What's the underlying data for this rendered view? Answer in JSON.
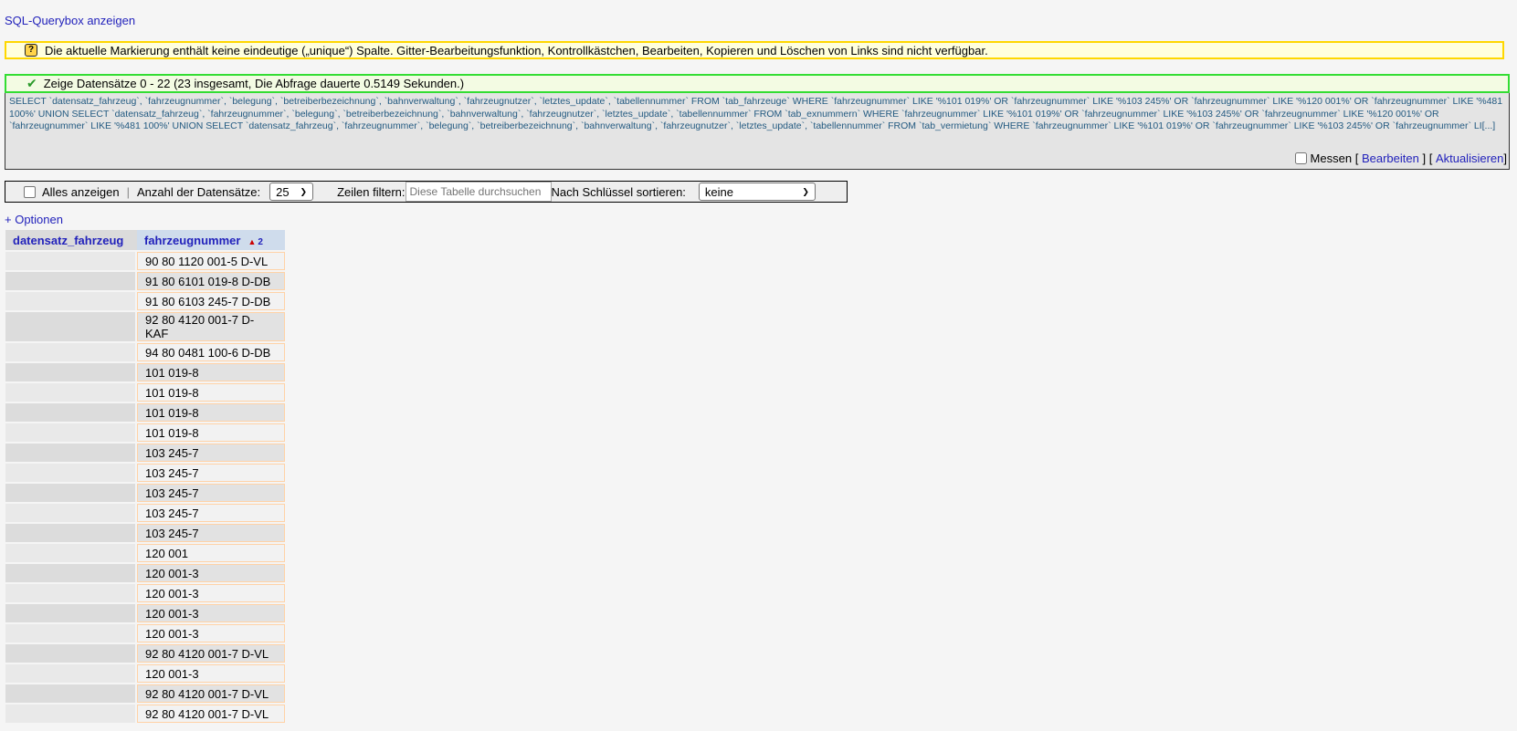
{
  "toplink": "SQL-Querybox anzeigen",
  "notice": "Die aktuelle Markierung enthält keine eindeutige („unique“) Spalte. Gitter-Bearbeitungsfunktion, Kontrollkästchen, Bearbeiten, Kopieren und Löschen von Links sind nicht verfügbar.",
  "success": "Zeige Datensätze 0 - 22 (23 insgesamt, Die Abfrage dauerte 0.5149 Sekunden.)",
  "sql": "SELECT `datensatz_fahrzeug`, `fahrzeugnummer`, `belegung`, `betreiberbezeichnung`, `bahnverwaltung`, `fahrzeugnutzer`, `letztes_update`, `tabellennummer` FROM `tab_fahrzeuge` WHERE `fahrzeugnummer` LIKE '%101 019%' OR `fahrzeugnummer` LIKE '%103 245%' OR `fahrzeugnummer` LIKE '%120 001%' OR `fahrzeugnummer` LIKE '%481 100%' UNION SELECT `datensatz_fahrzeug`, `fahrzeugnummer`, `belegung`, `betreiberbezeichnung`, `bahnverwaltung`, `fahrzeugnutzer`, `letztes_update`, `tabellennummer` FROM `tab_exnummern` WHERE `fahrzeugnummer` LIKE '%101 019%' OR `fahrzeugnummer` LIKE '%103 245%' OR `fahrzeugnummer` LIKE '%120 001%' OR `fahrzeugnummer` LIKE '%481 100%' UNION SELECT `datensatz_fahrzeug`, `fahrzeugnummer`, `belegung`, `betreiberbezeichnung`, `bahnverwaltung`, `fahrzeugnutzer`, `letztes_update`, `tabellennummer` FROM `tab_vermietung` WHERE `fahrzeugnummer` LIKE '%101 019%' OR `fahrzeugnummer` LIKE '%103 245%' OR `fahrzeugnummer` LI[...]",
  "sqlbar": {
    "messen": "Messen",
    "open1": "[",
    "bearbeiten": "Bearbeiten",
    "mid": "] [",
    "aktualisieren": "Aktualisieren",
    "close": "]"
  },
  "toolbar": {
    "show_all": "Alles anzeigen",
    "sep": "|",
    "count_label": "Anzahl der Datensätze:",
    "count_value": "25",
    "filter_label": "Zeilen filtern:",
    "filter_placeholder": "Diese Tabelle durchsuchen",
    "sort_label": "Nach Schlüssel sortieren:",
    "sort_value": "keine"
  },
  "optionen": "+ Optionen",
  "table": {
    "headers": [
      "datensatz_fahrzeug",
      "fahrzeugnummer"
    ],
    "sort_index": "2",
    "rows": [
      "90 80 1120 001-5 D-VL",
      "91 80 6101 019-8 D-DB",
      "91 80 6103 245-7 D-DB",
      "92 80 4120 001-7 D-KAF",
      "94 80 0481 100-6 D-DB",
      "101 019-8",
      "101 019-8",
      "101 019-8",
      "101 019-8",
      "103 245-7",
      "103 245-7",
      "103 245-7",
      "103 245-7",
      "103 245-7",
      "120 001",
      "120 001-3",
      "120 001-3",
      "120 001-3",
      "120 001-3",
      "92 80 4120 001-7 D-VL",
      "120 001-3",
      "92 80 4120 001-7 D-VL",
      "92 80 4120 001-7 D-VL"
    ]
  }
}
